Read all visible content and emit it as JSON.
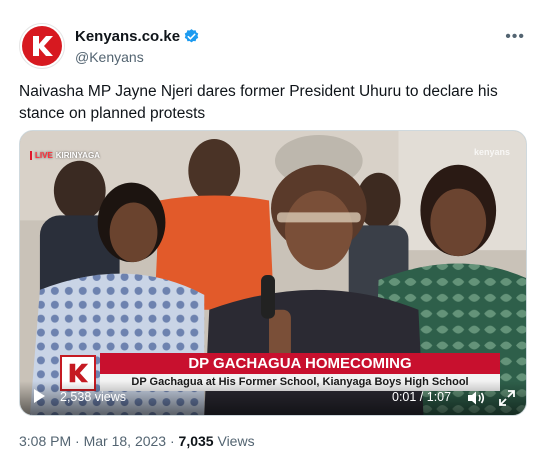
{
  "author": {
    "name": "Kenyans.co.ke",
    "handle": "@Kenyans",
    "avatar_letter": "K",
    "verified": true
  },
  "more_icon": "more-horizontal-icon",
  "tweet": {
    "text": "Naivasha MP Jayne Njeri dares former President Uhuru to declare his stance on planned protests"
  },
  "video": {
    "live_label": "LIVE",
    "location_label": "KIRINYAGA",
    "watermark": "kenyans",
    "headline": "DP GACHAGUA HOMECOMING",
    "subheadline": "DP Gachagua at His Former School, Kianyaga Boys High School",
    "views": "2,538 views",
    "progress": "0:01 / 1:07",
    "icons": [
      "play-icon",
      "volume-icon",
      "expand-icon"
    ]
  },
  "meta": {
    "time": "3:08 PM",
    "separator": "·",
    "date": "Mar 18, 2023",
    "views_count": "7,035",
    "views_label": "Views"
  },
  "colors": {
    "brand_red": "#d71920",
    "verified_blue": "#1d9bf0",
    "headline_red": "#c8102e"
  }
}
